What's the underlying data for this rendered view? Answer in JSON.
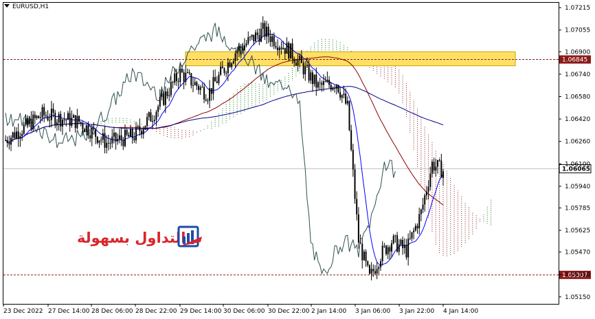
{
  "symbol": "EURUSD,H1",
  "logo_text": "التداول بسهولة",
  "chart_data": {
    "type": "candlestick",
    "symbol": "EURUSD",
    "timeframe": "H1",
    "ylim": [
      1.051,
      1.0725
    ],
    "y_ticks": [
      "1.07215",
      "1.07055",
      "1.06900",
      "1.06740",
      "1.06580",
      "1.06420",
      "1.06260",
      "1.06100",
      "1.05940",
      "1.05785",
      "1.05625",
      "1.05470",
      "1.05310",
      "1.05150"
    ],
    "x_ticks": [
      "23 Dec 2022",
      "27 Dec 14:00",
      "28 Dec 06:00",
      "28 Dec 22:00",
      "29 Dec 14:00",
      "30 Dec 06:00",
      "30 Dec 22:00",
      "2 Jan 14:00",
      "3 Jan 06:00",
      "3 Jan 22:00",
      "4 Jan 14:00"
    ],
    "current_price": "1.06065",
    "levels": [
      {
        "label": "1.06845",
        "value": 1.06845,
        "color": "#8b1a1a"
      },
      {
        "label": "1.05307",
        "value": 1.05307,
        "color": "#8b1a1a"
      }
    ],
    "zone": {
      "from": 1.068,
      "to": 1.069,
      "color": "#ffe066"
    },
    "colors": {
      "bull": "#000000",
      "bear": "#000000",
      "ma_fast": "#8b0000",
      "ma_slow": "#00008b",
      "kijun": "#0000ff",
      "chikou": "#2f4f4f",
      "cloud_bull": "#1a7a1a",
      "cloud_bear": "#8b1a1a",
      "grid": "#c8c8c8"
    }
  }
}
